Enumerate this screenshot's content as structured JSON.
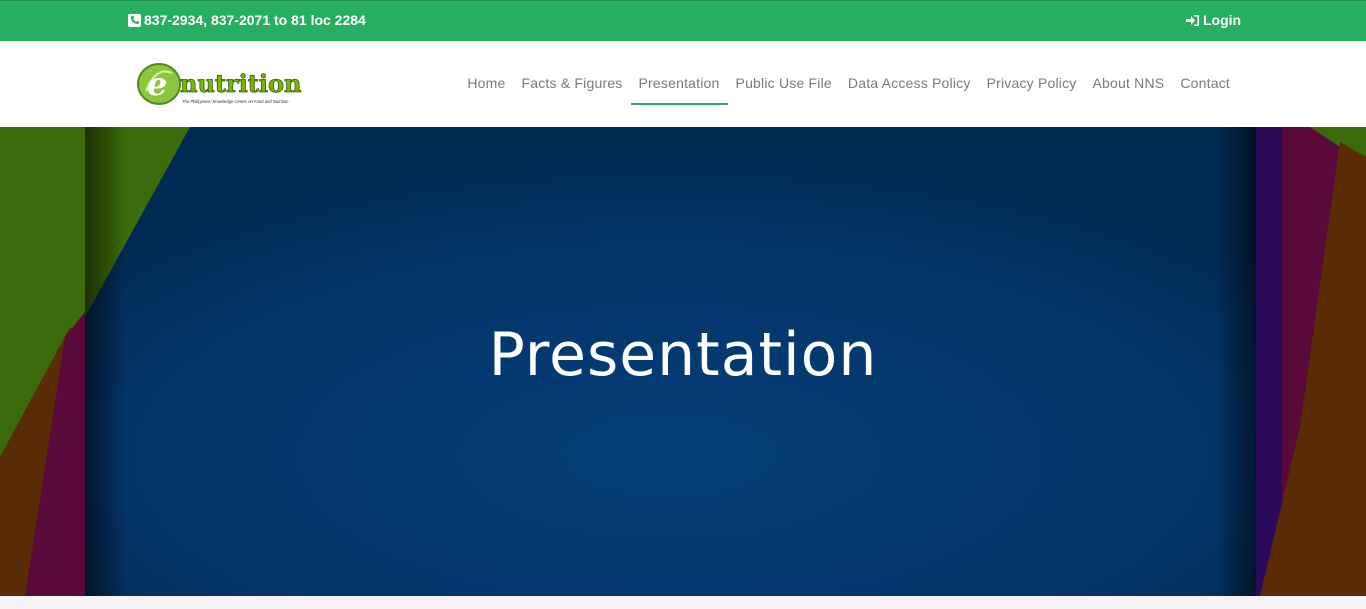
{
  "topbar": {
    "phone": "837-2934, 837-2071 to 81 loc 2284",
    "login": "Login",
    "color": "#27ae60"
  },
  "logo": {
    "wordmark": "nutrition",
    "letter": "e",
    "tagline": "The Philippines' Knowledge Center on Food and Nutrition"
  },
  "nav": {
    "items": [
      {
        "label": "Home"
      },
      {
        "label": "Facts & Figures"
      },
      {
        "label": "Presentation",
        "active": true
      },
      {
        "label": "Public Use File"
      },
      {
        "label": "Data Access Policy"
      },
      {
        "label": "Privacy Policy"
      },
      {
        "label": "About NNS"
      },
      {
        "label": "Contact"
      }
    ]
  },
  "hero": {
    "title": "Presentation",
    "colors": {
      "panel": "#043468",
      "green": "#3b6b0a",
      "maroon": "#5a0a3a",
      "orange": "#5a2c05",
      "purple": "#2b0a5c"
    }
  }
}
